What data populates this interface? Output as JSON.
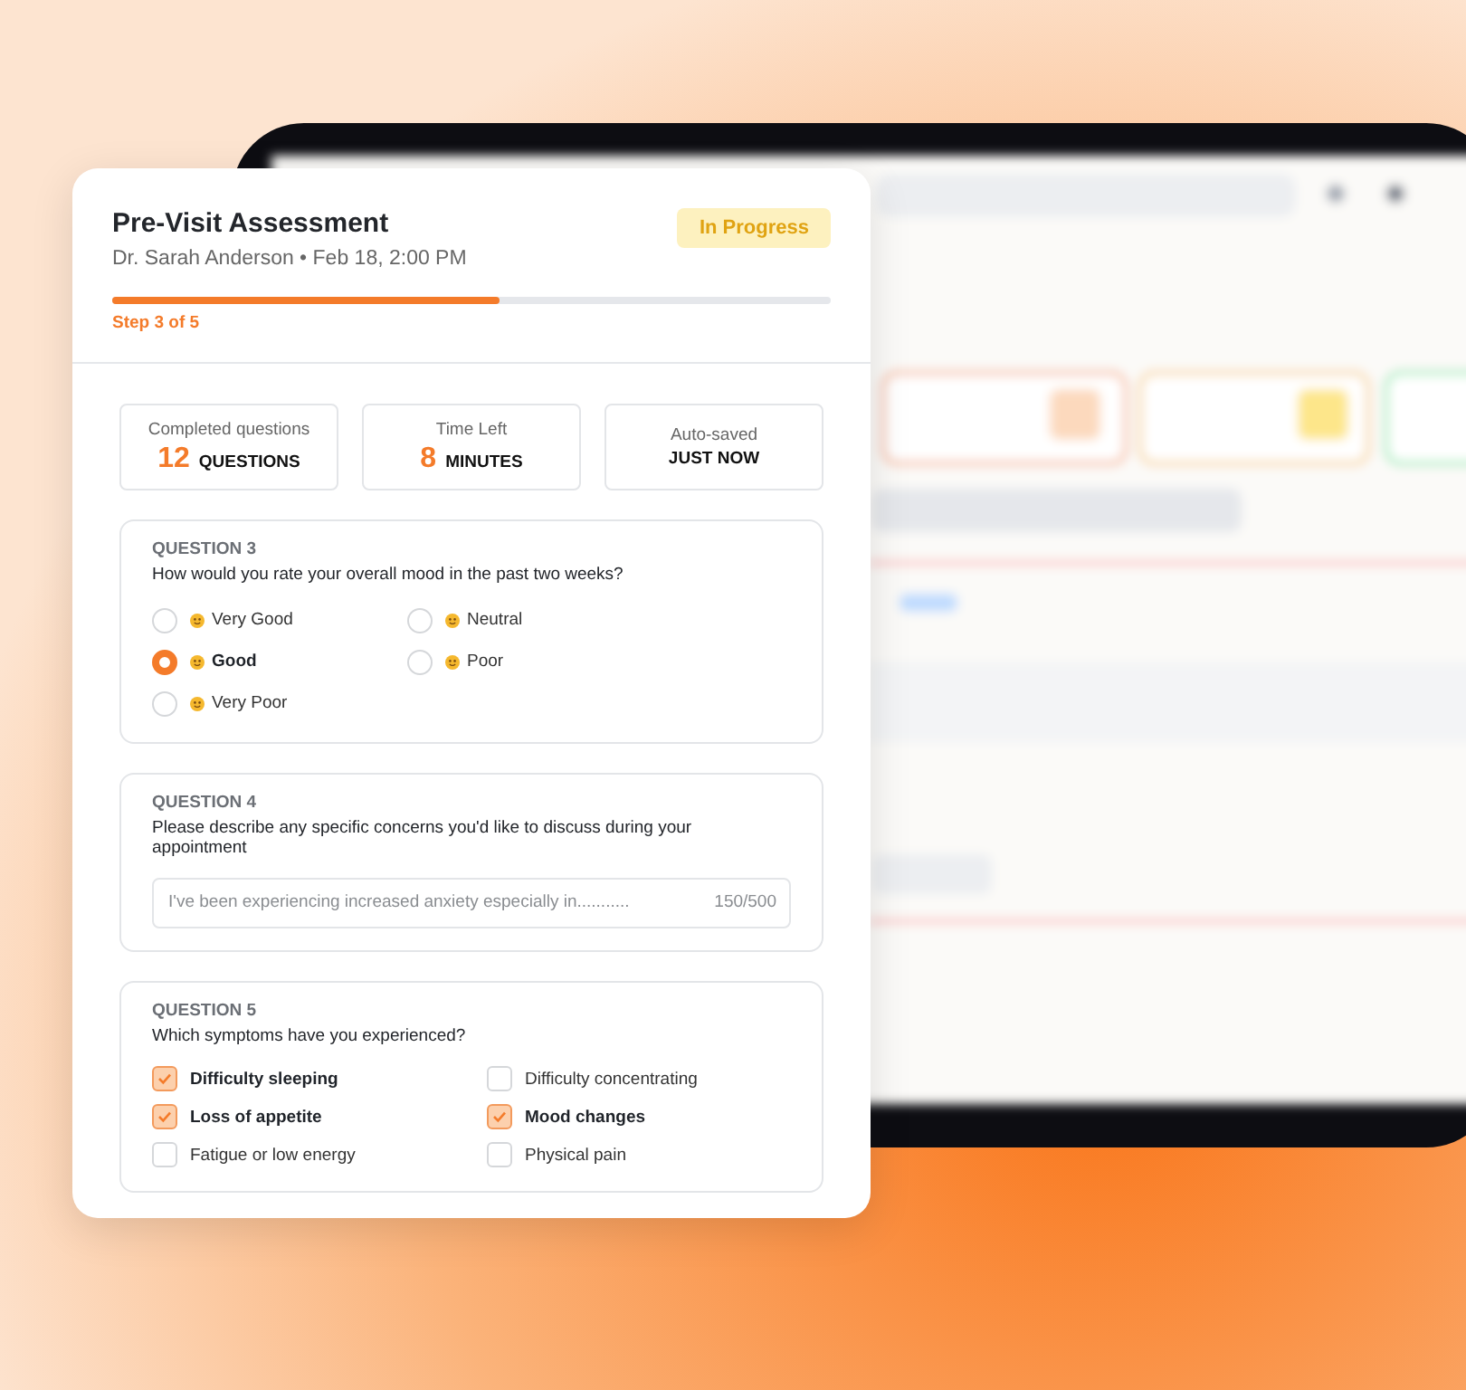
{
  "assessment": {
    "title": "Pre-Visit Assessment",
    "subtitle": "Dr. Sarah Anderson • Feb 18, 2:00 PM",
    "status": "In Progress",
    "progress": {
      "level": 0.54,
      "label": "Step 3 of 5"
    }
  },
  "stats": [
    {
      "label": "Completed questions",
      "number": "12",
      "unit": "QUESTIONS"
    },
    {
      "label": "Time Left",
      "number": "8",
      "unit": "MINUTES"
    },
    {
      "label": "Auto-saved",
      "unit": "JUST NOW"
    }
  ],
  "questions": [
    {
      "kind": "radio",
      "number": "QUESTION 3",
      "text": "How would you rate your overall mood in the past two weeks?",
      "options": [
        {
          "label": "Very Good",
          "selected": false
        },
        {
          "label": "Neutral",
          "selected": false
        },
        {
          "label": "Good",
          "selected": true
        },
        {
          "label": "Poor",
          "selected": false
        },
        {
          "label": "Very Poor",
          "selected": false
        }
      ]
    },
    {
      "kind": "text",
      "number": "QUESTION 4",
      "text": "Please describe any specific concerns you'd like to discuss during your appointment",
      "placeholder": "I've been experiencing increased anxiety especially in...........",
      "count": "150/500"
    },
    {
      "kind": "checkbox",
      "number": "QUESTION 5",
      "text": "Which symptoms have you experienced?",
      "options": [
        {
          "label": "Difficulty sleeping",
          "checked": true
        },
        {
          "label": "Difficulty concentrating",
          "checked": false
        },
        {
          "label": "Loss of appetite",
          "checked": true
        },
        {
          "label": "Mood changes",
          "checked": true
        },
        {
          "label": "Fatigue or low energy",
          "checked": false
        },
        {
          "label": "Physical pain",
          "checked": false
        }
      ]
    }
  ]
}
